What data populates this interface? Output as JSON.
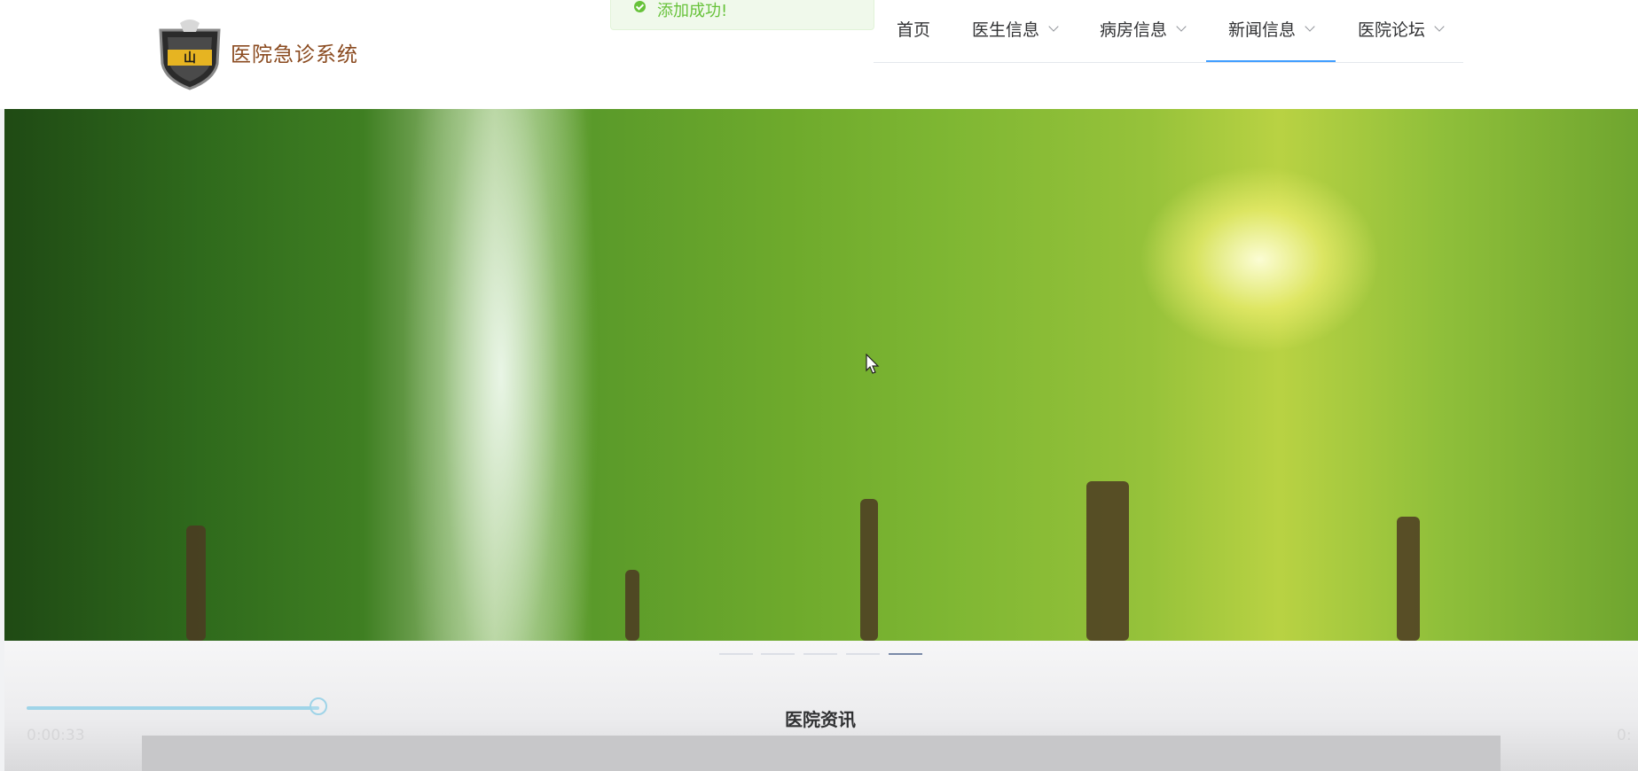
{
  "brand": {
    "name": "医院急诊系统",
    "logo_icon": "shield-eagle-logo-icon"
  },
  "toast": {
    "message": "添加成功!",
    "icon": "check-circle-icon",
    "color": "#67c23a"
  },
  "nav": {
    "items": [
      {
        "label": "首页",
        "has_dropdown": false
      },
      {
        "label": "医生信息",
        "has_dropdown": true
      },
      {
        "label": "病房信息",
        "has_dropdown": true
      },
      {
        "label": "新闻信息",
        "has_dropdown": true,
        "active": true
      },
      {
        "label": "医院论坛",
        "has_dropdown": true
      }
    ],
    "active_color": "#409eff"
  },
  "carousel": {
    "slide_count": 5,
    "active_index": 4
  },
  "section": {
    "title": "医院资讯"
  },
  "player": {
    "elapsed": "0:00:33",
    "right_time_partial": "0:"
  }
}
